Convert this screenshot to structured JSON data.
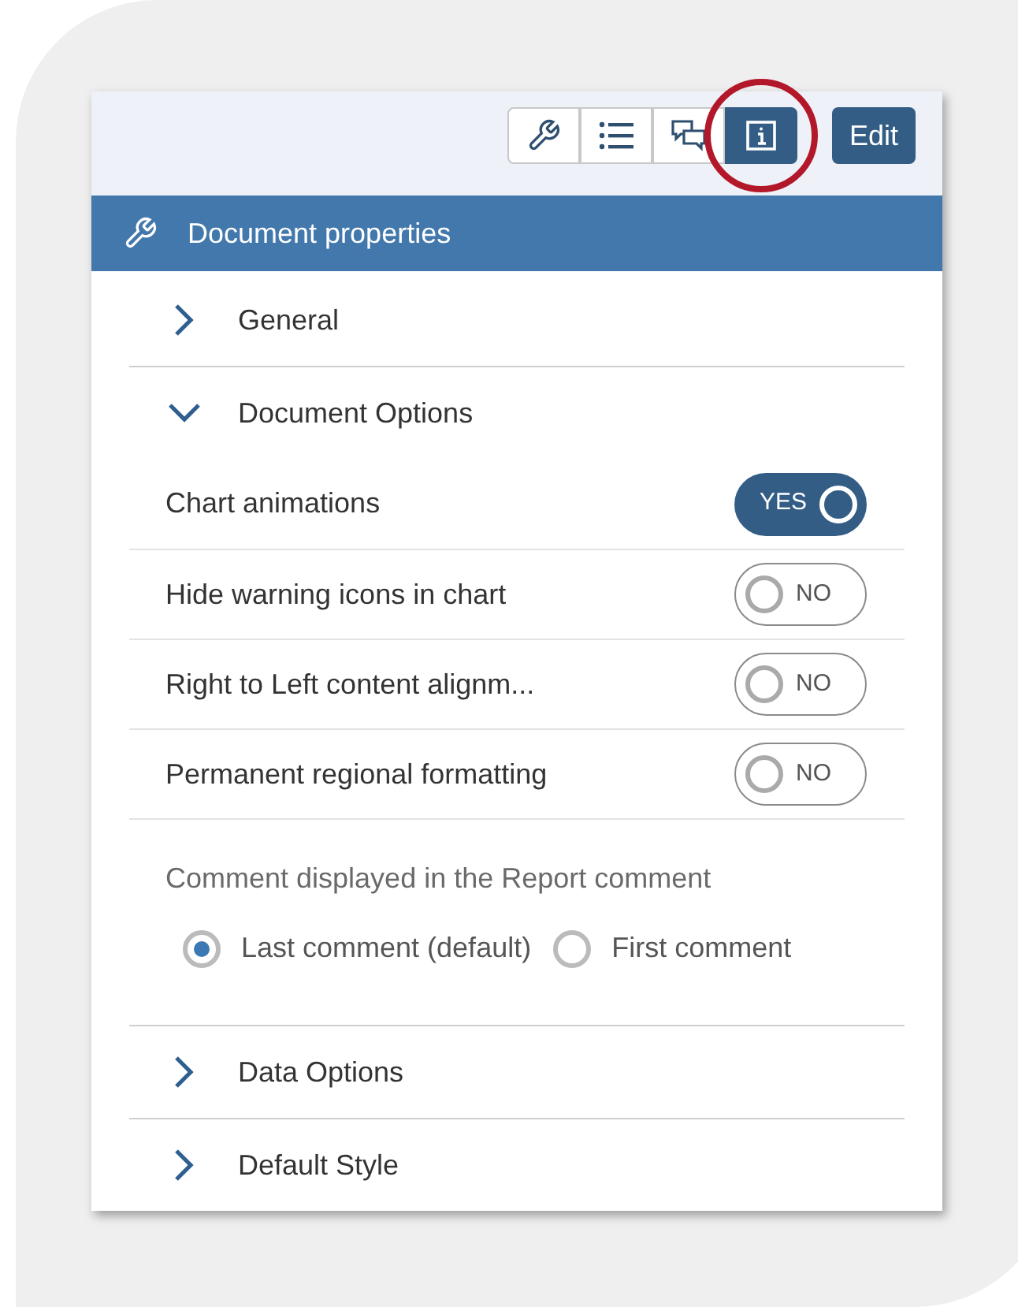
{
  "toolbar": {
    "buttons": [
      {
        "kind": "wrench",
        "selected": false,
        "highlighted": false
      },
      {
        "kind": "list",
        "selected": false,
        "highlighted": false
      },
      {
        "kind": "comments",
        "selected": false,
        "highlighted": false
      },
      {
        "kind": "info",
        "selected": true,
        "highlighted": true
      }
    ],
    "edit_button": "Edit"
  },
  "header": {
    "title": "Document properties"
  },
  "sections": [
    {
      "title": "General",
      "expanded": false
    },
    {
      "title": "Document Options",
      "expanded": true,
      "options": [
        {
          "label": "Chart animations",
          "on": true,
          "text": "YES"
        },
        {
          "label": "Hide warning icons in chart",
          "on": false,
          "text": "NO"
        },
        {
          "label": "Right to Left content alignm...",
          "on": false,
          "text": "NO"
        },
        {
          "label": "Permanent regional formatting",
          "on": false,
          "text": "NO"
        }
      ],
      "comment_setting": {
        "label": "Comment displayed in the Report comment",
        "radios": [
          {
            "label": "Last comment (default)",
            "selected": true
          },
          {
            "label": "First comment",
            "selected": false
          }
        ]
      }
    },
    {
      "title": "Data Options",
      "expanded": false
    },
    {
      "title": "Default Style",
      "expanded": false
    }
  ]
}
